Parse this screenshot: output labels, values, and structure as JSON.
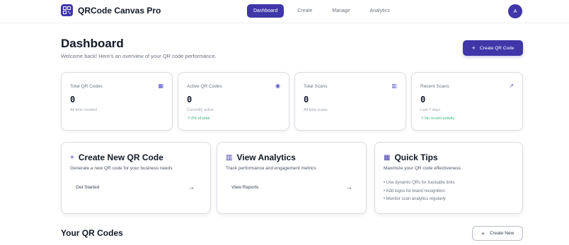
{
  "app": {
    "name": "QRCode Canvas Pro",
    "logo_icon": "qr-code-icon"
  },
  "nav": {
    "items": [
      {
        "label": "Dashboard",
        "active": true
      },
      {
        "label": "Create",
        "active": false
      },
      {
        "label": "Manage",
        "active": false
      },
      {
        "label": "Analytics",
        "active": false
      }
    ]
  },
  "user": {
    "avatar_initial": "A"
  },
  "header": {
    "title": "Dashboard",
    "subtitle": "Welcome back! Here's an overview of your QR code performance.",
    "create_button": {
      "icon": "+",
      "label": "Create QR Code"
    }
  },
  "stats": [
    {
      "label": "Total QR Codes",
      "icon_name": "qr-code-icon",
      "icon": "▦",
      "value": "0",
      "note": "All time created",
      "trend": ""
    },
    {
      "label": "Active QR Codes",
      "icon_name": "eye-icon",
      "icon": "◉",
      "value": "0",
      "note": "Currently active",
      "trend": "↗ 0% of total"
    },
    {
      "label": "Total Scans",
      "icon_name": "bar-chart-icon",
      "icon": "▥",
      "value": "0",
      "note": "All time scans",
      "trend": ""
    },
    {
      "label": "Recent Scans",
      "icon_name": "trending-up-icon",
      "icon": "↗",
      "value": "0",
      "note": "Last 7 days",
      "trend": "↗ No recent activity"
    }
  ],
  "actions": {
    "create": {
      "icon": "+",
      "title": "Create New QR Code",
      "description": "Generate a new QR code for your business needs",
      "link": "Get Started",
      "arrow": "→"
    },
    "analytics": {
      "icon": "▥",
      "title": "View Analytics",
      "description": "Track performance and engagement metrics",
      "link": "View Reports",
      "arrow": "→"
    },
    "tips": {
      "icon": "▦",
      "title": "Quick Tips",
      "description": "Maximize your QR code effectiveness",
      "items": [
        "• Use dynamic QRs for trackable links",
        "• Add logos for brand recognition",
        "• Monitor scan analytics regularly"
      ]
    }
  },
  "qr_section": {
    "title": "Your QR Codes",
    "create_new_button": {
      "icon": "+",
      "label": "Create New"
    }
  },
  "colors": {
    "accent": "#3f36a8",
    "trend_green": "#34b27b",
    "border": "#d9dce2"
  }
}
